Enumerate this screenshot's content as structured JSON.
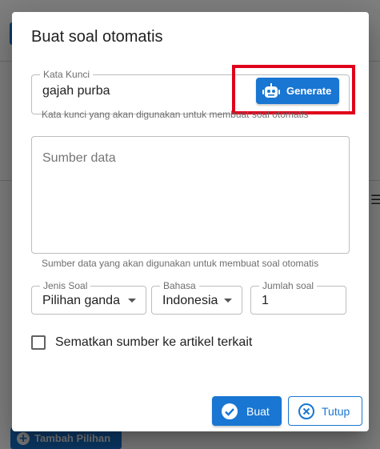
{
  "background": {
    "add_button_label": "Tambah Pilihan"
  },
  "dialog": {
    "title": "Buat soal otomatis",
    "keyword": {
      "label": "Kata Kunci",
      "value": "gajah purba",
      "helper": "Kata kunci yang akan digunakan untuk membuat soal otomatis",
      "generate_label": "Generate",
      "generate_icon": "robot-icon"
    },
    "source": {
      "placeholder": "Sumber data",
      "helper": "Sumber data yang akan digunakan untuk membuat soal otomatis"
    },
    "question_type": {
      "label": "Jenis Soal",
      "value": "Pilihan ganda"
    },
    "language": {
      "label": "Bahasa",
      "value": "Indonesia"
    },
    "count": {
      "label": "Jumlah soal",
      "value": "1"
    },
    "embed_checkbox": {
      "label": "Sematkan sumber ke artikel terkait",
      "checked": false
    },
    "actions": {
      "create_label": "Buat",
      "close_label": "Tutup"
    }
  },
  "colors": {
    "primary": "#1976d2",
    "highlight": "#e0001b"
  }
}
